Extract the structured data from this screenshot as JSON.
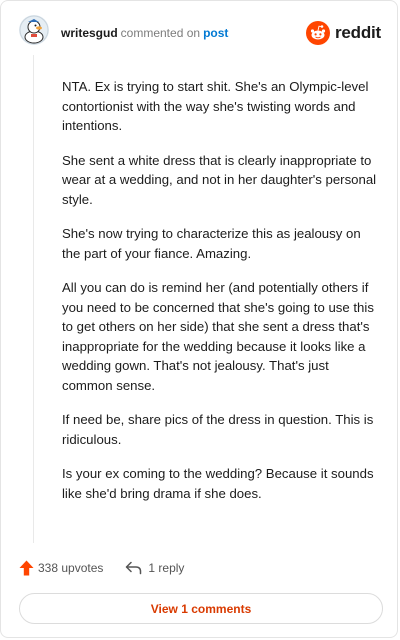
{
  "header": {
    "username": "writesgud",
    "action": "commented on",
    "post_link": "post",
    "brand": "reddit"
  },
  "comment": {
    "paragraphs": [
      "NTA. Ex is trying to start shit. She's an Olympic-level contortionist with the way she's twisting words and intentions.",
      "She sent a white dress that is clearly inappropriate to wear at a wedding, and not in her daughter's personal style.",
      "She's now trying to characterize this as jealousy on the part of your fiance. Amazing.",
      "All you can do is remind her (and potentially others if you need to be concerned that she's going to use this to get others on her side) that she sent a dress that's inappropriate for the wedding because it looks like a wedding gown. That's not jealousy. That's just common sense.",
      "If need be, share pics of the dress in question. This is ridiculous.",
      "Is your ex coming to the wedding? Because it sounds like she'd bring drama if she does."
    ]
  },
  "footer": {
    "upvotes": "338 upvotes",
    "reply": "1 reply",
    "view_comments": "View 1 comments"
  },
  "colors": {
    "brand_orange": "#ff4500",
    "link_blue": "#0079d3",
    "view_button_text": "#d93a00"
  },
  "icons": {
    "avatar": "snoo-duck-avatar",
    "brand": "reddit-snoo-logo",
    "upvote": "upvote-arrow-icon",
    "reply": "reply-arrow-icon"
  }
}
